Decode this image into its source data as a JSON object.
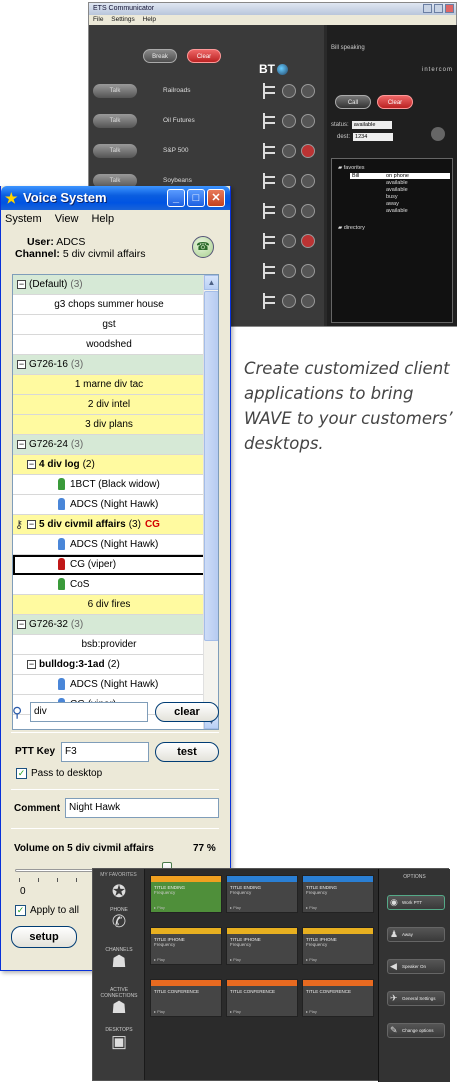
{
  "ets": {
    "title": "ETS Communicator",
    "menu": [
      "File",
      "Settings",
      "Help"
    ],
    "buttons": {
      "break": "Break",
      "clear": "Clear",
      "call": "Call",
      "clear2": "Clear"
    },
    "brand": "BT",
    "status_text": "Bill speaking",
    "intercom": "intercom",
    "lines": [
      {
        "talk": "Talk",
        "name": "Railroads"
      },
      {
        "talk": "Talk",
        "name": "Oil Futures"
      },
      {
        "talk": "Talk",
        "name": "S&P 500"
      },
      {
        "talk": "Talk",
        "name": "Soybeans"
      }
    ],
    "status_label": "status:",
    "status_value": "available",
    "dest_label": "dest:",
    "dest_value": "1234",
    "favorites_label": "favorites",
    "directory_label": "directory",
    "favorites": [
      {
        "name": "Bill",
        "status": "on phone"
      },
      {
        "name": "",
        "status": "available"
      },
      {
        "name": "",
        "status": "available"
      },
      {
        "name": "",
        "status": "busy"
      },
      {
        "name": "",
        "status": "away"
      },
      {
        "name": "",
        "status": "available"
      }
    ]
  },
  "voice": {
    "title": "Voice System",
    "menu": [
      "System",
      "View",
      "Help"
    ],
    "user_label": "User:",
    "user_value": "ADCS",
    "channel_label": "Channel:",
    "channel_value": "5 div civmil affairs",
    "tree": [
      {
        "kind": "grp",
        "label": "(Default)",
        "count": "(3)"
      },
      {
        "kind": "wht",
        "label": "g3 chops summer house"
      },
      {
        "kind": "wht",
        "label": "gst"
      },
      {
        "kind": "wht",
        "label": "woodshed"
      },
      {
        "kind": "grp",
        "label": "G726-16",
        "count": "(3)"
      },
      {
        "kind": "yel",
        "label": "1 marne div tac"
      },
      {
        "kind": "yel",
        "label": "2 div intel"
      },
      {
        "kind": "yel",
        "label": "3 div plans"
      },
      {
        "kind": "grp",
        "label": "G726-24",
        "count": "(3)"
      },
      {
        "kind": "yel",
        "label": "4 div log",
        "count": "(2)",
        "bold": true,
        "toggle": true
      },
      {
        "kind": "wht",
        "label": "1BCT (Black widow)",
        "person": "green"
      },
      {
        "kind": "wht",
        "label": "ADCS (Night Hawk)",
        "person": "blue"
      },
      {
        "kind": "yel",
        "label": "5 div civmil affairs",
        "count": "(3)",
        "tag": "CG",
        "bold": true,
        "toggle": true,
        "key": true
      },
      {
        "kind": "wht",
        "label": "ADCS (Night Hawk)",
        "person": "blue"
      },
      {
        "kind": "wht",
        "label": "CG (viper)",
        "person": "red",
        "selected": true
      },
      {
        "kind": "wht",
        "label": "CoS",
        "person": "green"
      },
      {
        "kind": "yel",
        "label": "6 div fires"
      },
      {
        "kind": "grp",
        "label": "G726-32",
        "count": "(3)"
      },
      {
        "kind": "wht",
        "label": "bsb:provider"
      },
      {
        "kind": "wht",
        "label": "bulldog:3-1ad",
        "count": "(2)",
        "bold": true,
        "toggle": true
      },
      {
        "kind": "wht",
        "label": "ADCS (Night Hawk)",
        "person": "blue"
      },
      {
        "kind": "wht",
        "label": "CG (viper)",
        "person": "blue"
      }
    ],
    "search_value": "div",
    "clear_label": "clear",
    "ptt_label": "PTT Key",
    "ptt_value": "F3",
    "test_label": "test",
    "pass_label": "Pass to desktop",
    "comment_label": "Comment",
    "comment_value": "Night Hawk",
    "volume_label": "Volume on 5 div civmil affairs",
    "volume_pct": "77 %",
    "volume_value": 0.77,
    "slider_min": "0",
    "apply_label": "Apply to all",
    "setup_label": "setup"
  },
  "caption": "Create customized client applications to bring WAVE to your customers’ desktops.",
  "dash": {
    "side_header": "MY FAVORITES",
    "nav": [
      "PHONE",
      "CHANNELS",
      "ACTIVE CONNECTIONS",
      "DESKTOPS"
    ],
    "tiles": [
      {
        "title": "TITLE ENDING",
        "sub": "Frequency",
        "bar": "#f0a020",
        "bg": "#4f8f3a"
      },
      {
        "title": "TITLE ENDING",
        "sub": "Frequency",
        "bar": "#2a7fd4",
        "bg": "#454545"
      },
      {
        "title": "TITLE ENDING",
        "sub": "Frequency",
        "bar": "#2a7fd4",
        "bg": "#454545"
      },
      {
        "title": "TITLE IPHONE",
        "sub": "Frequency",
        "bar": "#e8b020",
        "bg": "#454545"
      },
      {
        "title": "TITLE IPHONE",
        "sub": "Frequency",
        "bar": "#e8b020",
        "bg": "#454545"
      },
      {
        "title": "TITLE IPHONE",
        "sub": "Frequency",
        "bar": "#e8b020",
        "bg": "#454545"
      },
      {
        "title": "TITLE CONFERENCE",
        "sub": "",
        "bar": "#e86a20",
        "bg": "#454545"
      },
      {
        "title": "TITLE CONFERENCE",
        "sub": "",
        "bar": "#e86a20",
        "bg": "#454545"
      },
      {
        "title": "TITLE CONFERENCE",
        "sub": "",
        "bar": "#e86a20",
        "bg": "#454545"
      }
    ],
    "tile_footer": "Play",
    "options_header": "OPTIONS",
    "options": [
      "Work PTT",
      "Away",
      "Speaker On",
      "General Settings",
      "Change options"
    ]
  }
}
